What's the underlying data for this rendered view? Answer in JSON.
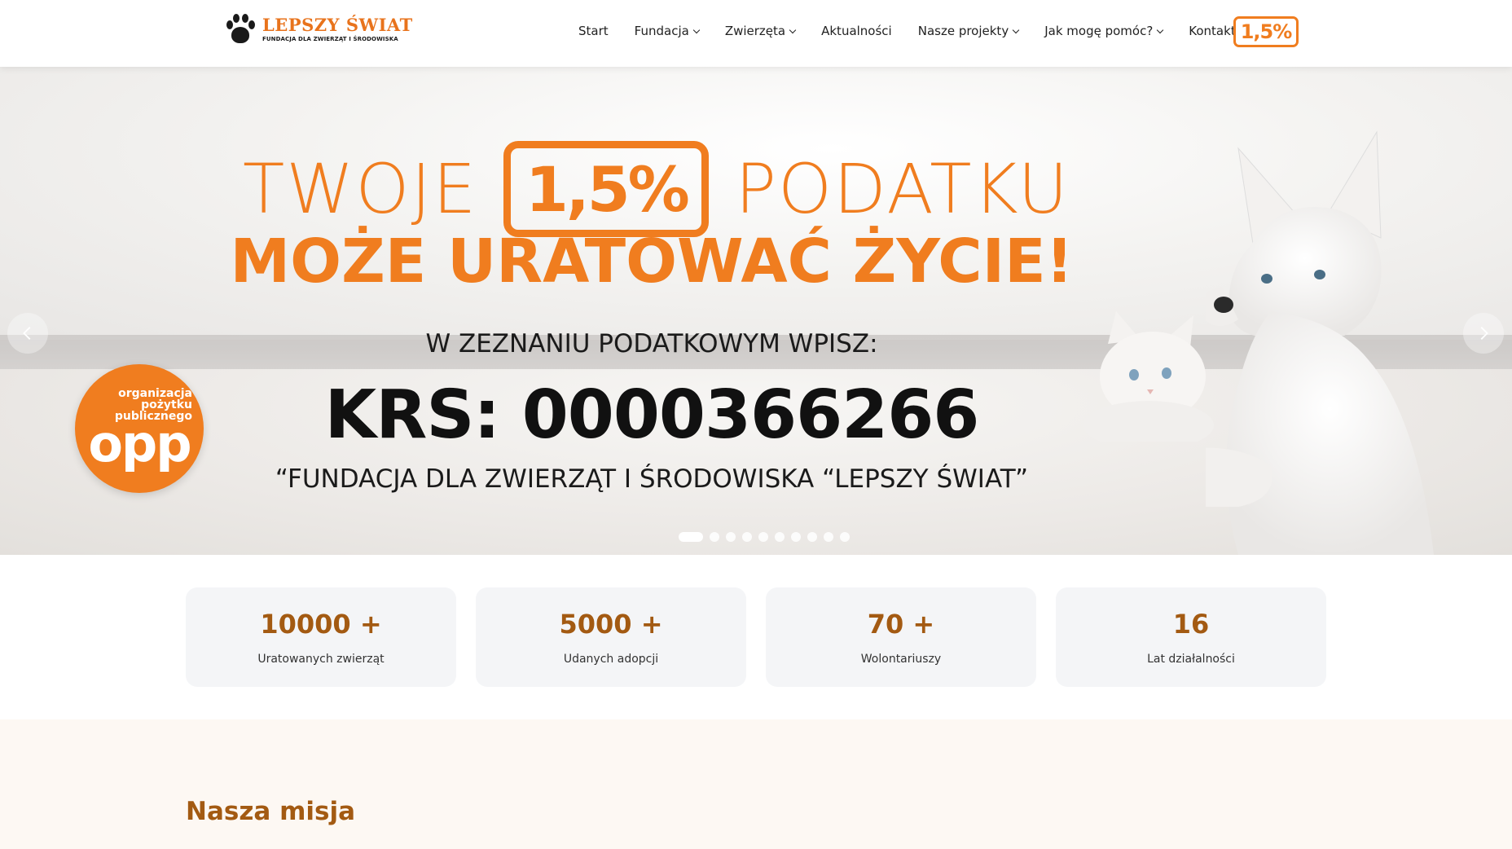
{
  "header": {
    "logo_title": "LEPSZY ŚWIAT",
    "logo_subtitle": "FUNDACJA DLA ZWIERZĄT I ŚRODOWISKA",
    "nav": [
      {
        "label": "Start",
        "dropdown": false
      },
      {
        "label": "Fundacja",
        "dropdown": true
      },
      {
        "label": "Zwierzęta",
        "dropdown": true
      },
      {
        "label": "Aktualności",
        "dropdown": false
      },
      {
        "label": "Nasze projekty",
        "dropdown": true
      },
      {
        "label": "Jak mogę pomóc?",
        "dropdown": true
      },
      {
        "label": "Kontakt",
        "dropdown": false
      }
    ],
    "badge": "1,5%"
  },
  "hero": {
    "twoje": "TWOJE",
    "badge": "1,5%",
    "podatku": "PODATKU",
    "headline": "MOŻE URATOWAĆ ŻYCIE!",
    "instruction": "W ZEZNANIU PODATKOWYM WPISZ:",
    "krs": "KRS: 0000366266",
    "foundation": "“FUNDACJA DLA ZWIERZĄT I ŚRODOWISKA “LEPSZY ŚWIAT”",
    "opp_small": "organizacja pożytku publicznego",
    "opp_big": "opp",
    "slides_count": 10,
    "active_slide": 0
  },
  "stats": [
    {
      "value": "10000 +",
      "label": "Uratowanych zwierząt"
    },
    {
      "value": "5000 +",
      "label": "Udanych adopcji"
    },
    {
      "value": "70 +",
      "label": "Wolontariuszy"
    },
    {
      "value": "16",
      "label": "Lat działalności"
    }
  ],
  "mission": {
    "title": "Nasza misja"
  },
  "colors": {
    "accent": "#f07d1f",
    "stat_number": "#a35a12",
    "stat_bg": "#f4f5f7",
    "mission_bg": "#fdf8f3"
  }
}
